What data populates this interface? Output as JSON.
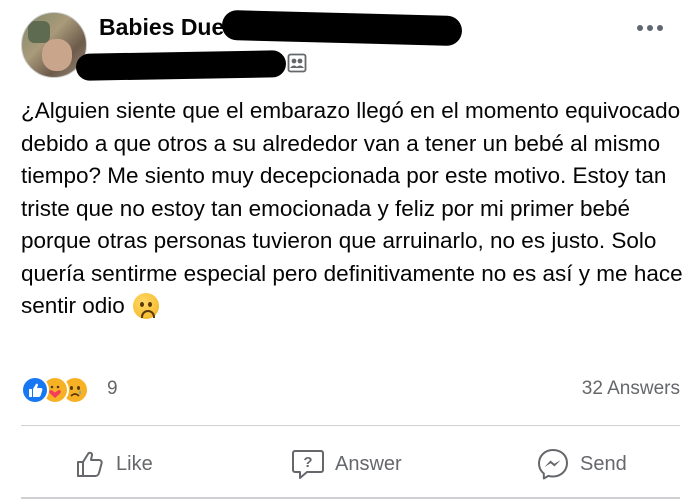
{
  "header": {
    "group_name": "Babies Due",
    "more_icon": "more-horizontal-icon",
    "privacy_icon": "group-members-icon"
  },
  "post": {
    "text": "¿Alguien siente que el embarazo llegó en el momento equivocado debido a que otros a su alrededor van a tener un bebé al mismo tiempo? Me siento muy decepcionada por este motivo. Estoy tan triste que no estoy tan emocionada y feliz por mi primer bebé porque otras personas tuvieron que arruinarlo, no es justo. Solo quería sentirme especial pero definitivamente no es así y me hace sentir odio",
    "emoji": "sad-face-icon"
  },
  "stats": {
    "reactions": [
      "like",
      "care",
      "sad"
    ],
    "reaction_count": "9",
    "answers_count": "32 Answers"
  },
  "actions": {
    "like_label": "Like",
    "answer_label": "Answer",
    "send_label": "Send"
  },
  "colors": {
    "like_blue": "#1877f2",
    "reaction_yellow": "#f7b125",
    "secondary_text": "#65676b",
    "divider": "#ced0d4"
  }
}
